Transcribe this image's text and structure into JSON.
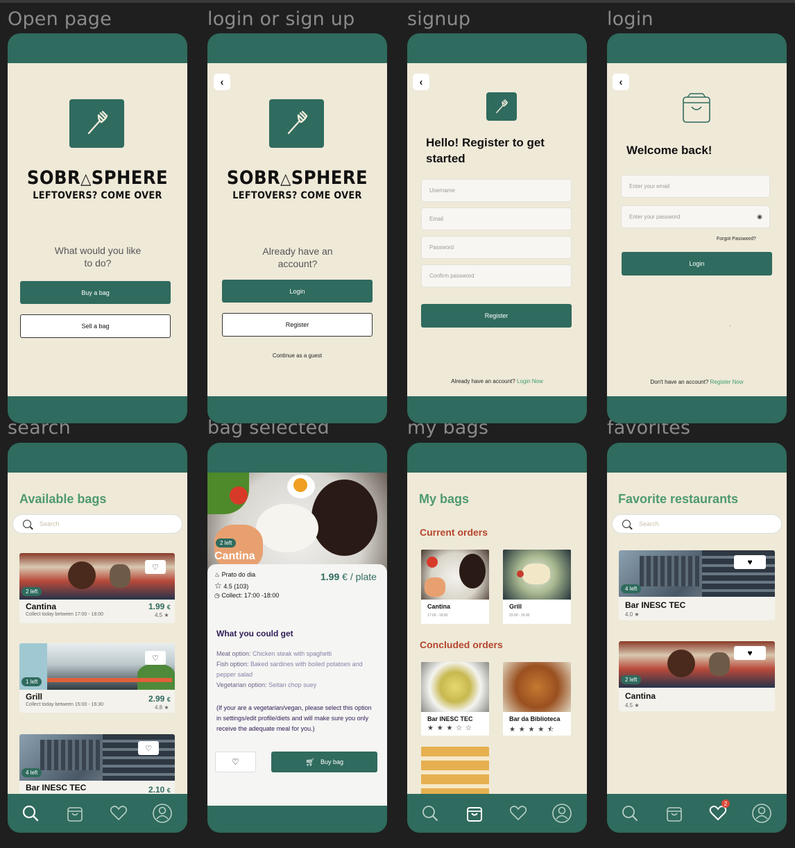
{
  "labels": {
    "open": "Open page",
    "loginsignup": "login or sign up",
    "signup": "signup",
    "login": "login",
    "search": "search",
    "bagselected": "bag selected",
    "mybags": "my bags",
    "favorites": "favorites"
  },
  "brand": {
    "name": "SOBRASPHERE",
    "name_left": "SOBR",
    "name_right": "SPHERE",
    "tagline": "LEFTOVERS? COME OVER"
  },
  "open": {
    "question": "What would you like to do?",
    "buy": "Buy a bag",
    "sell": "Sell a bag"
  },
  "choice": {
    "question": "Already have an account?",
    "login": "Login",
    "register": "Register",
    "guest": "Continue as a guest"
  },
  "signup": {
    "heading": "Hello! Register to get started",
    "username": "Username",
    "email": "Email",
    "password": "Password",
    "confirm": "Confirm password",
    "register": "Register",
    "footer_text": "Already have an account?",
    "footer_link": "Login Now"
  },
  "login": {
    "heading": "Welcome back!",
    "email": "Enter your email",
    "password": "Enter your password",
    "forgot": "Forgot Password?",
    "button": "Login",
    "dot": ".",
    "footer_text": "Don't have an account?",
    "footer_link": "Register Now"
  },
  "search_screen": {
    "title": "Available bags",
    "search_placeholder": "Search",
    "cards": [
      {
        "badge": "2 left",
        "name": "Cantina",
        "collect": "Collect today between 17:00 - 18:00",
        "price": "1.99",
        "currency": "€",
        "rating": "4.5"
      },
      {
        "badge": "1 left",
        "name": "Grill",
        "collect": "Collect today between 15:00 - 16:30",
        "price": "2.99",
        "currency": "€",
        "rating": "4.8"
      },
      {
        "badge": "4 left",
        "name": "Bar INESC TEC",
        "price": "2.10",
        "currency": "€"
      }
    ]
  },
  "bag": {
    "badge": "2 left",
    "name": "Cantina",
    "item": "Prato do dia",
    "rating": "4.5 (103)",
    "collect": "Collect: 17:00 -18:00",
    "price": "1.99",
    "unit": "€ / plate",
    "section": "What you could get",
    "meat_label": "Meat option:",
    "meat": "Chicken steak with spaghetti",
    "fish_label": "Fish option:",
    "fish": "Baked sardines with boiled potatoes and pepper salad",
    "veg_label": "Vegetarian option:",
    "veg": "Seitan chop suey",
    "note": "(If your are a vegetarian/vegan, please select this option in settings/edit profile/diets and will make sure you only receive the adequate meal for you.)",
    "buy": "Buy bag"
  },
  "mybags": {
    "title": "My bags",
    "current": "Current orders",
    "concluded": "Concluded orders",
    "current_orders": [
      {
        "name": "Cantina",
        "time": "17:00 - 18:00"
      },
      {
        "name": "Grill",
        "time": "15:00 - 16:30"
      }
    ],
    "concluded_orders": [
      {
        "name": "Bar INESC TEC",
        "stars": "★ ★ ★ ☆ ☆"
      },
      {
        "name": "Bar da Biblioteca",
        "stars": "★ ★ ★ ★ ⯪"
      }
    ]
  },
  "fav": {
    "title": "Favorite restaurants",
    "search_placeholder": "Search",
    "notif": "2",
    "cards": [
      {
        "badge": "4 left",
        "name": "Bar INESC TEC",
        "rating": "4.0"
      },
      {
        "badge": "2 left",
        "name": "Cantina",
        "rating": "4.5"
      }
    ]
  },
  "colors": {
    "primary": "#2f6b5e",
    "cream": "#efe9d8",
    "accent_green": "#4e9a6e",
    "red": "#b4472e"
  }
}
